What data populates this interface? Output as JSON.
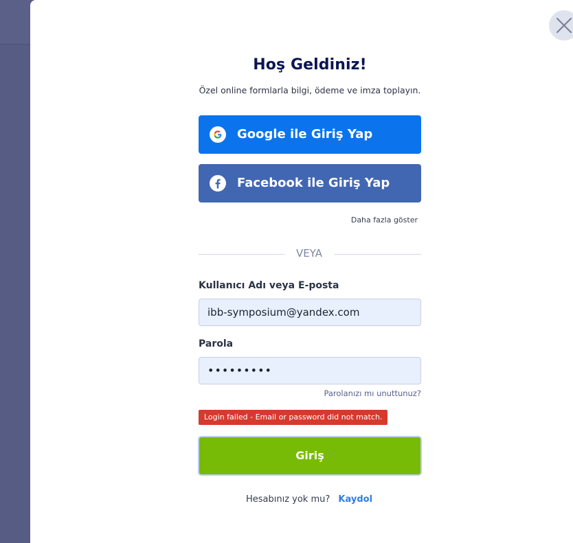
{
  "title": "Hoş Geldiniz!",
  "subtitle": "Özel online formlarla bilgi, ödeme ve imza toplayın.",
  "social": {
    "google_label": "Google ile Giriş Yap",
    "facebook_label": "Facebook ile Giriş Yap",
    "more_label": "Daha fazla göster"
  },
  "divider_text": "VEYA",
  "form": {
    "username_label": "Kullanıcı Adı veya E-posta",
    "username_value": "ibb-symposium@yandex.com",
    "password_label": "Parola",
    "password_value": "•••••••••",
    "forgot_label": "Parolanızı mı unuttunuz?",
    "error_message": "Login failed - Email or password did not match.",
    "submit_label": "Giriş"
  },
  "signup": {
    "question": "Hesabınız yok mu?",
    "link_label": "Kaydol"
  },
  "colors": {
    "google_button": "#0b74ec",
    "facebook_button": "#4267b2",
    "submit_button": "#78bb07",
    "error_bg": "#d63a2f",
    "title": "#0a1551",
    "input_bg": "#e8f0fe"
  },
  "icons": [
    "close-icon",
    "google-icon",
    "facebook-icon"
  ]
}
